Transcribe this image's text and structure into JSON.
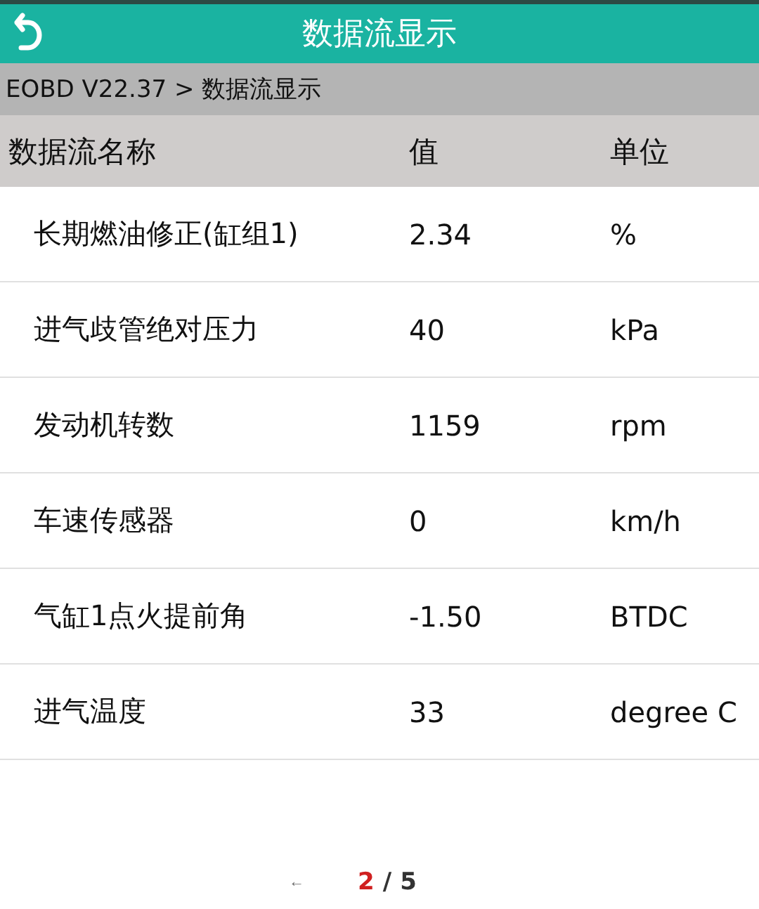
{
  "header": {
    "title": "数据流显示"
  },
  "breadcrumb": "EOBD V22.37 > 数据流显示",
  "table": {
    "columns": [
      "数据流名称",
      "值",
      "单位"
    ],
    "rows": [
      {
        "name": "长期燃油修正(缸组1)",
        "value": "2.34",
        "unit": "%"
      },
      {
        "name": "进气歧管绝对压力",
        "value": "40",
        "unit": "kPa"
      },
      {
        "name": "发动机转数",
        "value": "1159",
        "unit": "rpm"
      },
      {
        "name": "车速传感器",
        "value": "0",
        "unit": "km/h"
      },
      {
        "name": "气缸1点火提前角",
        "value": "-1.50",
        "unit": "BTDC"
      },
      {
        "name": "进气温度",
        "value": "33",
        "unit": "degree C"
      }
    ]
  },
  "pagination": {
    "prev": "←",
    "current": "2",
    "separator": "/",
    "total": "5"
  }
}
